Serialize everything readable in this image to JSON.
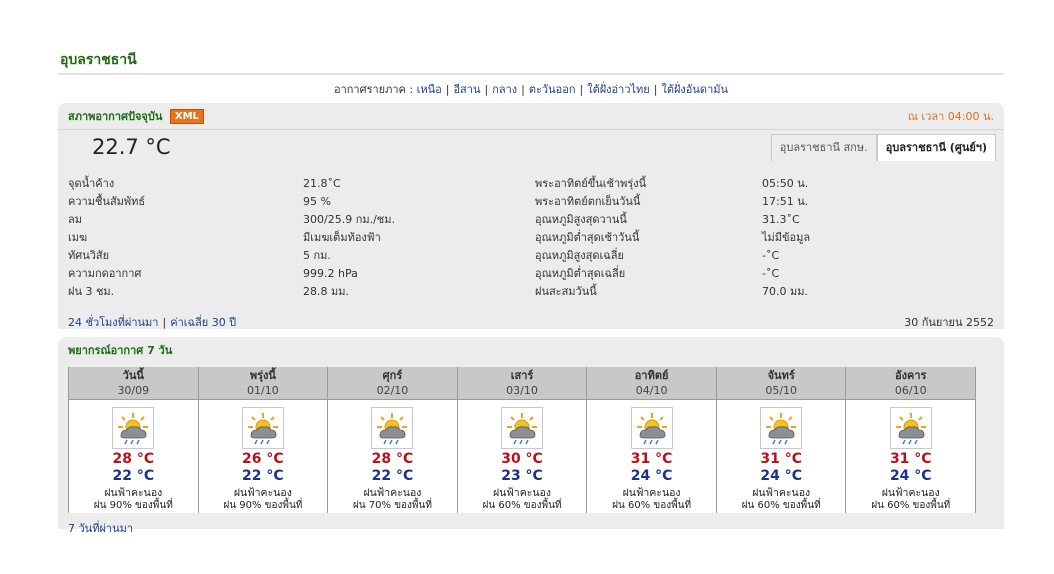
{
  "province": "อุบลราชธานี",
  "regions": {
    "prefix": "อากาศรายภาค :",
    "links": [
      "เหนือ",
      "อีสาน",
      "กลาง",
      "ตะวันออก",
      "ใต้ฝั่งอ่าวไทย",
      "ใต้ฝั่งอันดามัน"
    ]
  },
  "current": {
    "title": "สภาพอากาศปัจจุบัน",
    "xml_label": "XML",
    "time_label": "ณ เวลา 04:00 น.",
    "temperature": "22.7 °C",
    "tabs": [
      {
        "label": "อุบลราชธานี สกษ.",
        "active": false
      },
      {
        "label": "อุบลราชธานี (ศูนย์ฯ)",
        "active": true
      }
    ],
    "rows": [
      {
        "label1": "จุดน้ำค้าง",
        "value1": "21.8˚C",
        "label2": "พระอาทิตย์ขึ้นเช้าพรุ่งนี้",
        "value2": "05:50 น."
      },
      {
        "label1": "ความชื้นสัมพัทธ์",
        "value1": "95 %",
        "label2": "พระอาทิตย์ตกเย็นวันนี้",
        "value2": "17:51 น."
      },
      {
        "label1": "ลม",
        "value1": "300/25.9 กม./ชม.",
        "label2": "อุณหภูมิสูงสุดวานนี้",
        "value2": "31.3˚C"
      },
      {
        "label1": "เมฆ",
        "value1": "มีเมฆเต็มท้องฟ้า",
        "label2": "อุณหภูมิต่ำสุดเช้าวันนี้",
        "value2": "ไม่มีข้อมูล"
      },
      {
        "label1": "ทัศนวิสัย",
        "value1": "5 กม.",
        "label2": "อุณหภูมิสูงสุดเฉลี่ย",
        "value2": "-˚C"
      },
      {
        "label1": "ความกดอากาศ",
        "value1": "999.2 hPa",
        "label2": "อุณหภูมิต่ำสุดเฉลี่ย",
        "value2": "-˚C"
      },
      {
        "label1": "ฝน 3 ชม.",
        "value1": "28.8 มม.",
        "label2": "ฝนสะสมวันนี้",
        "value2": "70.0 มม."
      }
    ],
    "link_24h": "24 ชั่วโมงที่ผ่านมา",
    "link_avg": "ค่าเฉลี่ย 30 ปี",
    "date": "30 กันยายน 2552"
  },
  "forecast": {
    "title": "พยากรณ์อากาศ 7 วัน",
    "icon": "sun-cloud-rain-icon",
    "days": [
      {
        "day": "วันนี้",
        "date": "30/09",
        "max": "28 °C",
        "min": "22 °C",
        "desc": "ฝนฟ้าคะนอง",
        "rain": "ฝน 90% ของพื้นที่"
      },
      {
        "day": "พรุ่งนี้",
        "date": "01/10",
        "max": "26 °C",
        "min": "22 °C",
        "desc": "ฝนฟ้าคะนอง",
        "rain": "ฝน 90% ของพื้นที่"
      },
      {
        "day": "ศุกร์",
        "date": "02/10",
        "max": "28 °C",
        "min": "22 °C",
        "desc": "ฝนฟ้าคะนอง",
        "rain": "ฝน 70% ของพื้นที่"
      },
      {
        "day": "เสาร์",
        "date": "03/10",
        "max": "30 °C",
        "min": "23 °C",
        "desc": "ฝนฟ้าคะนอง",
        "rain": "ฝน 60% ของพื้นที่"
      },
      {
        "day": "อาทิตย์",
        "date": "04/10",
        "max": "31 °C",
        "min": "24 °C",
        "desc": "ฝนฟ้าคะนอง",
        "rain": "ฝน 60% ของพื้นที่"
      },
      {
        "day": "จันทร์",
        "date": "05/10",
        "max": "31 °C",
        "min": "24 °C",
        "desc": "ฝนฟ้าคะนอง",
        "rain": "ฝน 60% ของพื้นที่"
      },
      {
        "day": "อังคาร",
        "date": "06/10",
        "max": "31 °C",
        "min": "24 °C",
        "desc": "ฝนฟ้าคะนอง",
        "rain": "ฝน 60% ของพื้นที่"
      }
    ],
    "link_7days": "7 วันที่ผ่านมา"
  }
}
